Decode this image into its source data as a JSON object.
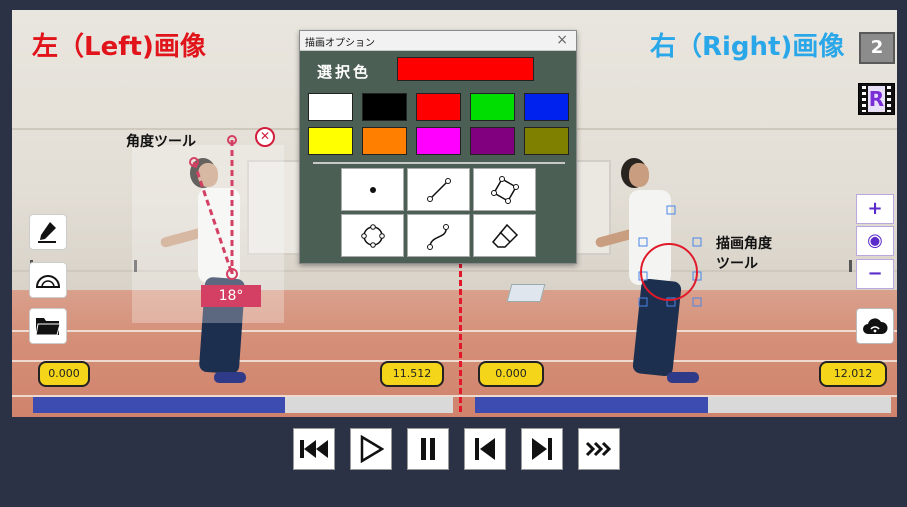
{
  "left_pane": {
    "title": "左（Left)画像",
    "angle_tool_label": "角度ツール",
    "angle_value": "18°",
    "start_time": "0.000",
    "end_time": "11.512",
    "progress_fraction": 0.6
  },
  "right_pane": {
    "title": "右（Right)画像",
    "draw_angle_tool_label_line1": "描画角度",
    "draw_angle_tool_label_line2": "ツール",
    "start_time": "0.000",
    "end_time": "12.012",
    "progress_fraction": 0.56,
    "layer_badge": "2",
    "film_badge": "R"
  },
  "draw_dialog": {
    "title": "描画オプション",
    "close_glyph": "×",
    "selected_color_label": "選択色",
    "selected_color": "#ff0000",
    "palette": [
      "#ffffff",
      "#000000",
      "#ff0000",
      "#00dd00",
      "#0022ee",
      "#ffff00",
      "#ff8000",
      "#ff00ff",
      "#800080",
      "#808000"
    ],
    "tools": [
      "point-tool",
      "line-tool",
      "polygon-tool",
      "circle-tool",
      "curve-tool",
      "eraser-tool"
    ]
  },
  "left_tools": [
    "marker-icon",
    "protractor-icon",
    "folder-icon"
  ],
  "zoom": {
    "plus": "+",
    "center": "◉",
    "minus": "−"
  },
  "transport": [
    "skip-to-start",
    "play",
    "pause",
    "step-back",
    "step-forward",
    "fast-forward"
  ],
  "colors": {
    "accent_red": "#e0141a",
    "accent_blue": "#2aa7e8",
    "progress": "#3c4cb1",
    "bubble": "#f4d51a",
    "background": "#2b3245"
  }
}
